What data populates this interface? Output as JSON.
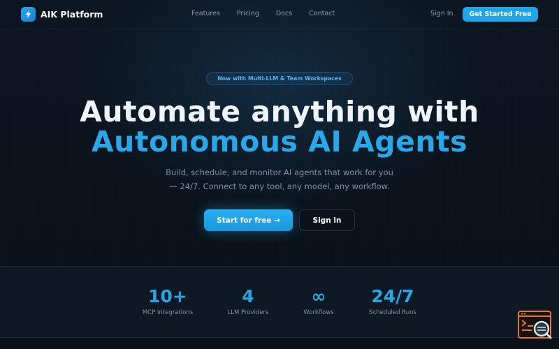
{
  "nav": {
    "brand": "AIK Platform",
    "links": [
      "Features",
      "Pricing",
      "Docs",
      "Contact"
    ],
    "signin": "Sign In",
    "cta": "Get Started Free"
  },
  "hero": {
    "badge": "Now with Multi-LLM & Team Workspaces",
    "title_line1": "Automate anything with",
    "title_line2": "Autonomous AI Agents",
    "subtitle_line1": "Build, schedule, and monitor AI agents that work for you",
    "subtitle_line2": "— 24/7. Connect to any tool, any model, any workflow.",
    "primary_button": "Start for free →",
    "secondary_button": "Sign in"
  },
  "stats": [
    {
      "value": "10+",
      "label": "MCP Integrations"
    },
    {
      "value": "4",
      "label": "LLM Providers"
    },
    {
      "value": "∞",
      "label": "Workflows"
    },
    {
      "value": "24/7",
      "label": "Scheduled Runs"
    }
  ],
  "colors": {
    "accent": "#28a8e8",
    "background": "#0a1119",
    "widget": "#e0783a"
  },
  "icons": {
    "logo": "bolt-icon",
    "widget": "terminal-search-icon"
  }
}
